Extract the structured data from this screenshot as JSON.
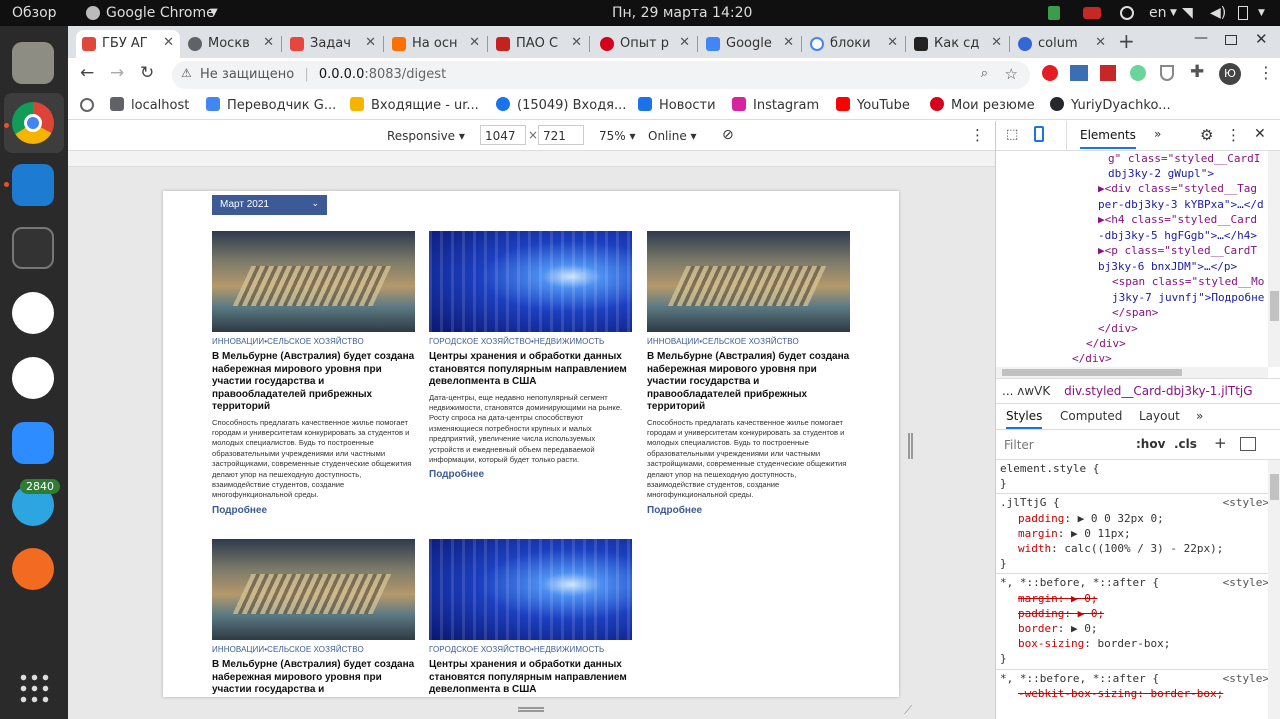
{
  "os": {
    "activities": "Обзор",
    "app_menu": "Google Chrome",
    "datetime": "Пн, 29 марта  14:20",
    "lang": "en",
    "dock_badge": "2840"
  },
  "browser": {
    "tabs": [
      {
        "label": "ГБУ АГ",
        "color": "#e0463a"
      },
      {
        "label": "Москв",
        "color": "#5f6368"
      },
      {
        "label": "Задач",
        "color": "#e8453c"
      },
      {
        "label": "На осн",
        "color": "#ff6f00"
      },
      {
        "label": "ПАО С",
        "color": "#c5221f"
      },
      {
        "label": "Опыт р",
        "color": "#d6001c"
      },
      {
        "label": "Google",
        "color": "#4285f4"
      },
      {
        "label": "блоки",
        "color": "#4285f4"
      },
      {
        "label": "Как сд",
        "color": "#222222"
      },
      {
        "label": "colum",
        "color": "#3367d6"
      }
    ],
    "url_security": "Не защищено",
    "url_host": "0.0.0.0",
    "url_rest": ":8083/digest",
    "profile_letter": "Ю",
    "bookmarks": [
      {
        "label": "localhost",
        "color": "#5f6368"
      },
      {
        "label": "Переводчик G...",
        "color": "#4285f4"
      },
      {
        "label": "Входящие - ur...",
        "color": "#f4b400"
      },
      {
        "label": "(15049) Входя...",
        "color": "#1a73e8"
      },
      {
        "label": "Новости",
        "color": "#1a73e8"
      },
      {
        "label": "Instagram",
        "color": "#d6249f"
      },
      {
        "label": "YouTube",
        "color": "#ff0000"
      },
      {
        "label": "Мои резюме",
        "color": "#d6001c"
      },
      {
        "label": "YuriyDyachko...",
        "color": "#24292e"
      }
    ]
  },
  "devicebar": {
    "mode": "Responsive ▾",
    "width": "1047",
    "times": "×",
    "height": "721",
    "zoom": "75% ▾",
    "network": "Online ▾"
  },
  "site": {
    "month": "Март 2021",
    "cards": [
      {
        "img": "city",
        "tag": "ИННОВАЦИИ•СЕЛЬСКОЕ ХОЗЯЙСТВО",
        "title": "В Мельбурне (Австралия) будет создана набережная мирового уровня при участии государства и правообладателей прибрежных территорий",
        "desc": "Способность предлагать качественное жилье помогает городам и университетам конкурировать за студентов и молодых специалистов. Будь то построенные образовательными учреждениями или частными застройщиками, современные студенческие общежития делают упор на пешеходную доступность, взаимодействие студентов, создание многофункциональной среды.",
        "more": "Подробнее"
      },
      {
        "img": "data",
        "tag": "ГОРОДСКОЕ ХОЗЯЙСТВО•НЕДВИЖИМОСТЬ",
        "title": "Центры хранения и обработки данных становятся популярным направлением девелопмента в США",
        "desc": "Дата-центры, еще недавно непопулярный сегмент недвижимости, становятся доминирующими на рынке. Росту спроса на дата-центры способствуют изменяющиеся потребности крупных и малых предприятий, увеличение числа используемых устройств и ежедневный объем передаваемой информации, который будет только расти.",
        "more": "Подробнее"
      },
      {
        "img": "city",
        "tag": "ИННОВАЦИИ•СЕЛЬСКОЕ ХОЗЯЙСТВО",
        "title": "В Мельбурне (Австралия) будет создана набережная мирового уровня при участии государства и правообладателей прибрежных территорий",
        "desc": "Способность предлагать качественное жилье помогает городам и университетам конкурировать за студентов и молодых специалистов. Будь то построенные образовательными учреждениями или частными застройщиками, современные студенческие общежития делают упор на пешеходную доступность, взаимодействие студентов, создание многофункциональной среды.",
        "more": "Подробнее"
      },
      {
        "img": "city",
        "tag": "ИННОВАЦИИ•СЕЛЬСКОЕ ХОЗЯЙСТВО",
        "title": "В Мельбурне (Австралия) будет создана набережная мирового уровня при участии государства и",
        "desc": "",
        "more": ""
      },
      {
        "img": "data",
        "tag": "ГОРОДСКОЕ ХОЗЯЙСТВО•НЕДВИЖИМОСТЬ",
        "title": "Центры хранения и обработки данных становятся популярным направлением девелопмента в США",
        "desc": "",
        "more": ""
      }
    ]
  },
  "devtools": {
    "elements_tab": "Elements",
    "tree": [
      "g\" class=\"styled__CardI",
      "dbj3ky-2 gWupl\">",
      "▶<div class=\"styled__Tag",
      "per-dbj3ky-3 kYBPxa\">…</d",
      "▶<h4 class=\"styled__Card",
      "-dbj3ky-5 hgFGgb\">…</h4>",
      "▶<p class=\"styled__CardT",
      "bj3ky-6 bnxJDM\">…</p>",
      "<span class=\"styled__Mo",
      "j3ky-7 juvnfj\">Подробне",
      "</span>",
      "</div>",
      "</div>",
      "</div>"
    ],
    "crumb_prev": "... ᴧwVK",
    "crumb_current": "div.styled__Card-dbj3ky-1.jlTtjG",
    "tabs2": [
      "Styles",
      "Computed",
      "Layout"
    ],
    "filter_placeholder": "Filter",
    "hov": ":hov",
    "cls": ".cls",
    "styles": {
      "element_style": "element.style {",
      "close": "}",
      "r1_selector": ".jlTtjG {",
      "r1_src": "<style>",
      "r1_p1n": "padding",
      "r1_p1v": ": ▶ 0 0 32px 0;",
      "r1_p2n": "margin",
      "r1_p2v": ": ▶ 0 11px;",
      "r1_p3n": "width",
      "r1_p3v": ": calc((100% / 3) - 22px);",
      "r2_selector": "*, *::before, *::after {",
      "r2_src": "<style>",
      "r2_p1": "margin: ▶ 0;",
      "r2_p2": "padding: ▶ 0;",
      "r2_p3n": "border",
      "r2_p3v": ": ▶ 0;",
      "r2_p4n": "box-sizing",
      "r2_p4v": ": border-box;",
      "r3_selector": "*, *::before, *::after {",
      "r3_src": "<style>",
      "r3_p1": "-webkit-box-sizing: border-box;"
    }
  }
}
